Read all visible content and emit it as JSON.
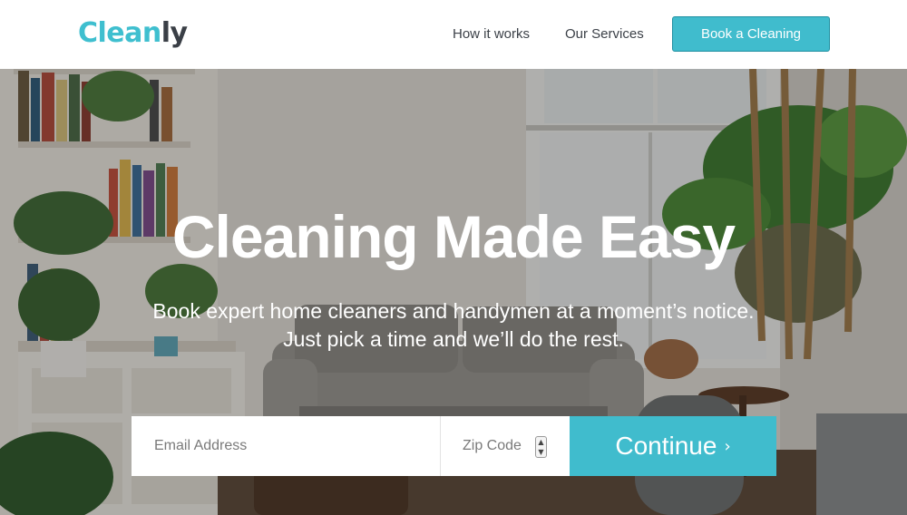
{
  "header": {
    "logo_part1": "Clean",
    "logo_part2": "ly",
    "nav": {
      "how_it_works": "How it works",
      "our_services": "Our Services"
    },
    "cta_label": "Book a Cleaning"
  },
  "hero": {
    "title": "Cleaning Made Easy",
    "subtitle_line1": "Book expert home cleaners and handymen at a moment’s notice.",
    "subtitle_line2": "Just pick a time and we’ll do the rest."
  },
  "form": {
    "email_placeholder": "Email Address",
    "zip_placeholder": "Zip Code",
    "continue_label": "Continue",
    "continue_icon": "chevron-right-icon"
  },
  "colors": {
    "accent": "#40bccd",
    "logo_dark": "#3a3f46",
    "nav_text": "#3c4148"
  }
}
